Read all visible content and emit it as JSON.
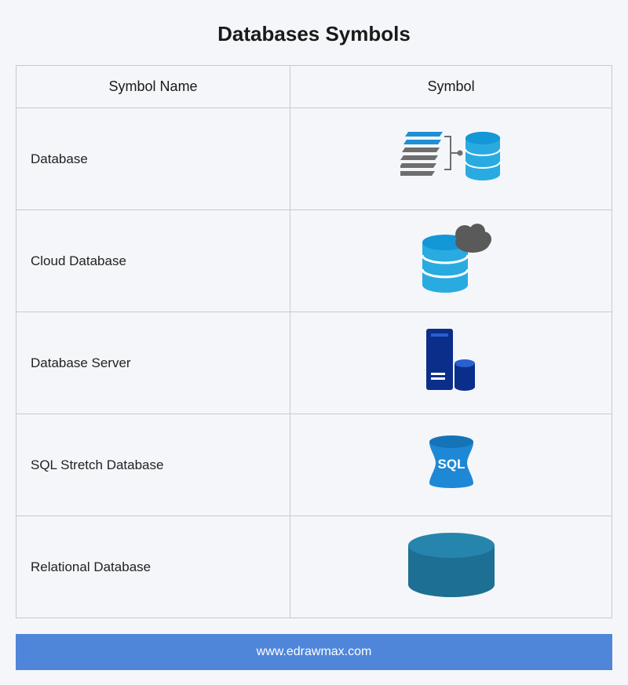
{
  "title": "Databases Symbols",
  "columns": {
    "name": "Symbol Name",
    "symbol": "Symbol"
  },
  "rows": [
    {
      "name": "Database",
      "icon": "database"
    },
    {
      "name": "Cloud Database",
      "icon": "cloud-database"
    },
    {
      "name": "Database Server",
      "icon": "database-server"
    },
    {
      "name": "SQL Stretch Database",
      "icon": "sql-stretch"
    },
    {
      "name": "Relational Database",
      "icon": "relational-database"
    }
  ],
  "sql_label": "SQL",
  "footer": "www.edrawmax.com"
}
